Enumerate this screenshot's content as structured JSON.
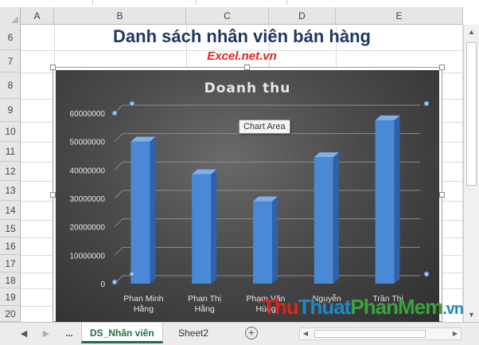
{
  "columns": [
    "A",
    "B",
    "C",
    "D",
    "E"
  ],
  "rows": [
    "6",
    "7",
    "8",
    "9",
    "10",
    "11",
    "12",
    "13",
    "14",
    "15",
    "16",
    "17",
    "18",
    "19",
    "20"
  ],
  "sheet": {
    "title": "Danh sách nhân viên bán hàng",
    "subtitle": "Excel.net.vn"
  },
  "chart_tooltip": "Chart Area",
  "chart_data": {
    "type": "bar",
    "title": "Doanh thu",
    "categories": [
      "Phan Minh Hằng",
      "Phan Thị Hằng",
      "Phạm Văn Hùng",
      "Nguyễn",
      "Trần Thị"
    ],
    "category_lines": [
      [
        "Phan  Minh",
        "Hằng"
      ],
      [
        "Phan  Thị",
        "Hằng"
      ],
      [
        "Phạm  Văn",
        "Hùng"
      ],
      [
        "Nguyễn"
      ],
      [
        "Trần  Thị"
      ]
    ],
    "values": [
      50000000,
      38500000,
      29000000,
      44500000,
      57500000
    ],
    "y_ticks": [
      "0",
      "10000000",
      "20000000",
      "30000000",
      "40000000",
      "50000000",
      "60000000"
    ],
    "ylim": [
      0,
      60000000
    ],
    "grid": true,
    "style": "3d-column",
    "colors": {
      "bar": "#4a89d6",
      "bar_side": "#2f62a8",
      "bar_top": "#7fb0ea",
      "background": "#3c3c3c",
      "text": "#e6e6e6"
    }
  },
  "tabs": {
    "prev_label": "◀",
    "next_label": "▶",
    "more_label": "...",
    "items": [
      "DS_Nhân viên",
      "Sheet2"
    ],
    "active": "DS_Nhân viên",
    "add_label": "+"
  },
  "watermark": {
    "part1": "Thu",
    "part2": "Thuat",
    "part3": "PhanMem",
    "part4": ".vn"
  }
}
